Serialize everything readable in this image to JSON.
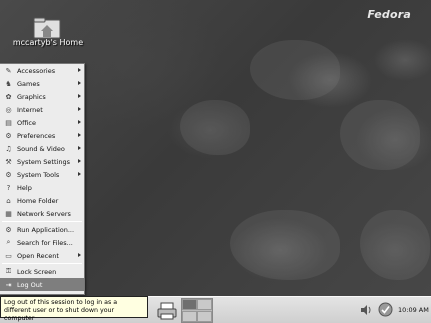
{
  "desktop": {
    "logo_text": "Fedora",
    "home_icon_label": "mccartyb's Home"
  },
  "menu": {
    "groups": [
      [
        {
          "label": "Accessories",
          "icon": "accessories-icon",
          "submenu": true
        },
        {
          "label": "Games",
          "icon": "games-icon",
          "submenu": true
        },
        {
          "label": "Graphics",
          "icon": "graphics-icon",
          "submenu": true
        },
        {
          "label": "Internet",
          "icon": "internet-icon",
          "submenu": true
        },
        {
          "label": "Office",
          "icon": "office-icon",
          "submenu": true
        },
        {
          "label": "Preferences",
          "icon": "preferences-icon",
          "submenu": true
        },
        {
          "label": "Sound & Video",
          "icon": "sound-video-icon",
          "submenu": true
        },
        {
          "label": "System Settings",
          "icon": "system-settings-icon",
          "submenu": true
        },
        {
          "label": "System Tools",
          "icon": "system-tools-icon",
          "submenu": true
        },
        {
          "label": "Help",
          "icon": "help-icon",
          "submenu": false
        },
        {
          "label": "Home Folder",
          "icon": "home-folder-icon",
          "submenu": false
        },
        {
          "label": "Network Servers",
          "icon": "network-servers-icon",
          "submenu": false
        }
      ],
      [
        {
          "label": "Run Application...",
          "icon": "run-application-icon",
          "submenu": false
        },
        {
          "label": "Search for Files...",
          "icon": "search-icon",
          "submenu": false
        },
        {
          "label": "Open Recent",
          "icon": "recent-icon",
          "submenu": true
        }
      ],
      [
        {
          "label": "Lock Screen",
          "icon": "lock-icon",
          "submenu": false
        },
        {
          "label": "Log Out",
          "icon": "logout-icon",
          "submenu": false,
          "selected": true
        }
      ]
    ]
  },
  "tooltip": {
    "text": "Log out of this session to log in as a different user or to shut down your computer"
  },
  "panel": {
    "clock": "10:09 AM"
  },
  "colors": {
    "menu_bg": "#ececec",
    "selection": "#7e7e7e",
    "tooltip_bg": "#ffffe1",
    "panel_bg": "#d9d9d9"
  }
}
